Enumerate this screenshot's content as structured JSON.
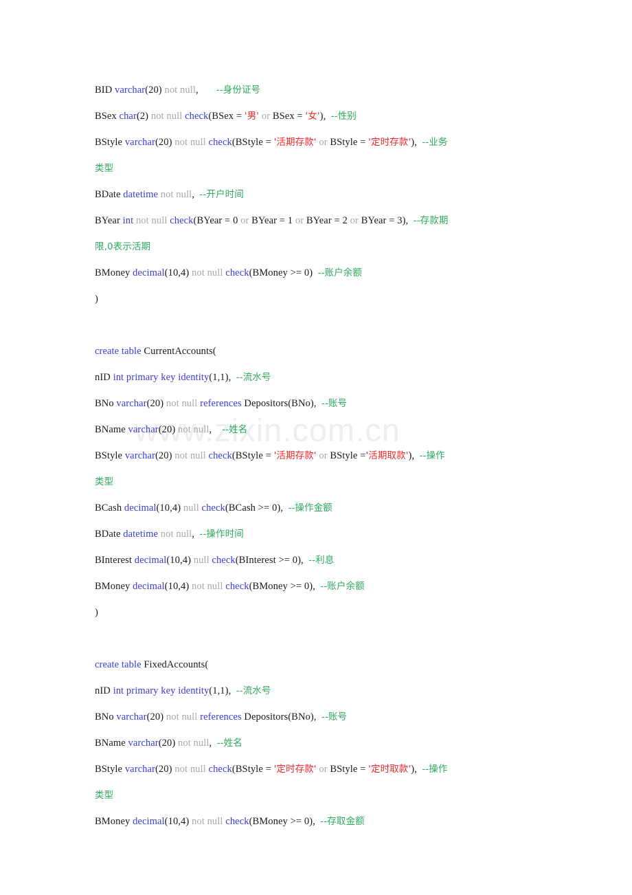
{
  "document": {
    "kind": "sql-source-listing",
    "watermark": "www.zixin.com.cn",
    "colors": {
      "keyword": "#3b3bd6",
      "nullable": "#a8a8a8",
      "comment": "#2ea95e",
      "string": "#ee2b2b",
      "identifier": "#1a1a1a",
      "background": "#ffffff",
      "watermark": "#eceff2"
    }
  },
  "lines": [
    {
      "id": "l01",
      "tokens": [
        {
          "t": "BID ",
          "c": "id"
        },
        {
          "t": "varchar",
          "c": "kw"
        },
        {
          "t": "(20) ",
          "c": "id"
        },
        {
          "t": "not null",
          "c": "nul"
        },
        {
          "t": ",       ",
          "c": "id"
        },
        {
          "t": "--身份证号",
          "c": "cmt"
        }
      ]
    },
    {
      "id": "l02",
      "tokens": [
        {
          "t": "BSex ",
          "c": "id"
        },
        {
          "t": "char",
          "c": "kw"
        },
        {
          "t": "(2) ",
          "c": "id"
        },
        {
          "t": "not null ",
          "c": "nul"
        },
        {
          "t": "check",
          "c": "kw"
        },
        {
          "t": "(BSex = ",
          "c": "id"
        },
        {
          "t": "'男'",
          "c": "str"
        },
        {
          "t": " or ",
          "c": "nul"
        },
        {
          "t": "BSex = ",
          "c": "id"
        },
        {
          "t": "'女'",
          "c": "str"
        },
        {
          "t": "),  ",
          "c": "id"
        },
        {
          "t": "--性别",
          "c": "cmt"
        }
      ]
    },
    {
      "id": "l03",
      "tokens": [
        {
          "t": "BStyle ",
          "c": "id"
        },
        {
          "t": "varchar",
          "c": "kw"
        },
        {
          "t": "(20) ",
          "c": "id"
        },
        {
          "t": "not null ",
          "c": "nul"
        },
        {
          "t": "check",
          "c": "kw"
        },
        {
          "t": "(BStyle = ",
          "c": "id"
        },
        {
          "t": "'活期存款'",
          "c": "str"
        },
        {
          "t": " or ",
          "c": "nul"
        },
        {
          "t": "BStyle = ",
          "c": "id"
        },
        {
          "t": "'定时存款'",
          "c": "str"
        },
        {
          "t": "),  ",
          "c": "id"
        },
        {
          "t": "--业务",
          "c": "cmt"
        }
      ]
    },
    {
      "id": "l04",
      "tokens": [
        {
          "t": "类型",
          "c": "cmt"
        }
      ]
    },
    {
      "id": "l05",
      "tokens": [
        {
          "t": "BDate ",
          "c": "id"
        },
        {
          "t": "datetime",
          "c": "kw"
        },
        {
          "t": " not null",
          "c": "nul"
        },
        {
          "t": ",  ",
          "c": "id"
        },
        {
          "t": "--开户时间",
          "c": "cmt"
        }
      ]
    },
    {
      "id": "l06",
      "tokens": [
        {
          "t": "BYear ",
          "c": "id"
        },
        {
          "t": "int",
          "c": "kw"
        },
        {
          "t": " not null ",
          "c": "nul"
        },
        {
          "t": "check",
          "c": "kw"
        },
        {
          "t": "(BYear = 0",
          "c": "id"
        },
        {
          "t": " or ",
          "c": "nul"
        },
        {
          "t": "BYear = 1",
          "c": "id"
        },
        {
          "t": " or ",
          "c": "nul"
        },
        {
          "t": "BYear = 2",
          "c": "id"
        },
        {
          "t": " or ",
          "c": "nul"
        },
        {
          "t": "BYear = 3),  ",
          "c": "id"
        },
        {
          "t": "--存款期",
          "c": "cmt"
        }
      ]
    },
    {
      "id": "l07",
      "tokens": [
        {
          "t": "限,0表示活期",
          "c": "cmt"
        }
      ]
    },
    {
      "id": "l08",
      "tokens": [
        {
          "t": "BMoney ",
          "c": "id"
        },
        {
          "t": "decimal",
          "c": "kw"
        },
        {
          "t": "(10,4) ",
          "c": "id"
        },
        {
          "t": "not null ",
          "c": "nul"
        },
        {
          "t": "check",
          "c": "kw"
        },
        {
          "t": "(BMoney >= 0)  ",
          "c": "id"
        },
        {
          "t": "--账户余额",
          "c": "cmt"
        }
      ]
    },
    {
      "id": "l09",
      "tokens": [
        {
          "t": ")",
          "c": "id"
        }
      ]
    },
    {
      "id": "l10",
      "tokens": []
    },
    {
      "id": "l11",
      "tokens": [
        {
          "t": "create table",
          "c": "kw"
        },
        {
          "t": " CurrentAccounts(",
          "c": "id"
        }
      ]
    },
    {
      "id": "l12",
      "tokens": [
        {
          "t": "nID ",
          "c": "id"
        },
        {
          "t": "int primary key identity",
          "c": "kw"
        },
        {
          "t": "(1,1),  ",
          "c": "id"
        },
        {
          "t": "--流水号",
          "c": "cmt"
        }
      ]
    },
    {
      "id": "l13",
      "tokens": [
        {
          "t": "BNo ",
          "c": "id"
        },
        {
          "t": "varchar",
          "c": "kw"
        },
        {
          "t": "(20) ",
          "c": "id"
        },
        {
          "t": "not null ",
          "c": "nul"
        },
        {
          "t": "references",
          "c": "kw"
        },
        {
          "t": " Depositors(BNo),  ",
          "c": "id"
        },
        {
          "t": "--账号",
          "c": "cmt"
        }
      ]
    },
    {
      "id": "l14",
      "tokens": [
        {
          "t": "BName ",
          "c": "id"
        },
        {
          "t": "varchar",
          "c": "kw"
        },
        {
          "t": "(20) ",
          "c": "id"
        },
        {
          "t": "not null",
          "c": "nul"
        },
        {
          "t": ",    ",
          "c": "id"
        },
        {
          "t": "--姓名",
          "c": "cmt"
        }
      ]
    },
    {
      "id": "l15",
      "tokens": [
        {
          "t": "BStyle ",
          "c": "id"
        },
        {
          "t": "varchar",
          "c": "kw"
        },
        {
          "t": "(20) ",
          "c": "id"
        },
        {
          "t": "not null ",
          "c": "nul"
        },
        {
          "t": "check",
          "c": "kw"
        },
        {
          "t": "(BStyle = ",
          "c": "id"
        },
        {
          "t": "'活期存款'",
          "c": "str"
        },
        {
          "t": " or ",
          "c": "nul"
        },
        {
          "t": "BStyle =",
          "c": "id"
        },
        {
          "t": "'活期取款'",
          "c": "str"
        },
        {
          "t": "),  ",
          "c": "id"
        },
        {
          "t": "--操作",
          "c": "cmt"
        }
      ]
    },
    {
      "id": "l16",
      "tokens": [
        {
          "t": "类型",
          "c": "cmt"
        }
      ]
    },
    {
      "id": "l17",
      "tokens": [
        {
          "t": "BCash ",
          "c": "id"
        },
        {
          "t": "decimal",
          "c": "kw"
        },
        {
          "t": "(10,4) ",
          "c": "id"
        },
        {
          "t": "null ",
          "c": "nul"
        },
        {
          "t": "check",
          "c": "kw"
        },
        {
          "t": "(BCash >= 0),  ",
          "c": "id"
        },
        {
          "t": "--操作金额",
          "c": "cmt"
        }
      ]
    },
    {
      "id": "l18",
      "tokens": [
        {
          "t": "BDate ",
          "c": "id"
        },
        {
          "t": "datetime",
          "c": "kw"
        },
        {
          "t": " not null",
          "c": "nul"
        },
        {
          "t": ",  ",
          "c": "id"
        },
        {
          "t": "--操作时间",
          "c": "cmt"
        }
      ]
    },
    {
      "id": "l19",
      "tokens": [
        {
          "t": "BInterest ",
          "c": "id"
        },
        {
          "t": "decimal",
          "c": "kw"
        },
        {
          "t": "(10,4) ",
          "c": "id"
        },
        {
          "t": "null ",
          "c": "nul"
        },
        {
          "t": "check",
          "c": "kw"
        },
        {
          "t": "(BInterest >= 0),  ",
          "c": "id"
        },
        {
          "t": "--利息",
          "c": "cmt"
        }
      ]
    },
    {
      "id": "l20",
      "tokens": [
        {
          "t": "BMoney ",
          "c": "id"
        },
        {
          "t": "decimal",
          "c": "kw"
        },
        {
          "t": "(10,4) ",
          "c": "id"
        },
        {
          "t": "not null ",
          "c": "nul"
        },
        {
          "t": "check",
          "c": "kw"
        },
        {
          "t": "(BMoney >= 0),  ",
          "c": "id"
        },
        {
          "t": "--账户余额",
          "c": "cmt"
        }
      ]
    },
    {
      "id": "l21",
      "tokens": [
        {
          "t": ")",
          "c": "id"
        }
      ]
    },
    {
      "id": "l22",
      "tokens": []
    },
    {
      "id": "l23",
      "tokens": [
        {
          "t": "create table",
          "c": "kw"
        },
        {
          "t": " FixedAccounts(",
          "c": "id"
        }
      ]
    },
    {
      "id": "l24",
      "tokens": [
        {
          "t": "nID ",
          "c": "id"
        },
        {
          "t": "int primary key identity",
          "c": "kw"
        },
        {
          "t": "(1,1),  ",
          "c": "id"
        },
        {
          "t": "--流水号",
          "c": "cmt"
        }
      ]
    },
    {
      "id": "l25",
      "tokens": [
        {
          "t": "BNo ",
          "c": "id"
        },
        {
          "t": "varchar",
          "c": "kw"
        },
        {
          "t": "(20) ",
          "c": "id"
        },
        {
          "t": "not null ",
          "c": "nul"
        },
        {
          "t": "references",
          "c": "kw"
        },
        {
          "t": " Depositors(BNo),  ",
          "c": "id"
        },
        {
          "t": "--账号",
          "c": "cmt"
        }
      ]
    },
    {
      "id": "l26",
      "tokens": [
        {
          "t": "BName ",
          "c": "id"
        },
        {
          "t": "varchar",
          "c": "kw"
        },
        {
          "t": "(20) ",
          "c": "id"
        },
        {
          "t": "not null",
          "c": "nul"
        },
        {
          "t": ",  ",
          "c": "id"
        },
        {
          "t": "--姓名",
          "c": "cmt"
        }
      ]
    },
    {
      "id": "l27",
      "tokens": [
        {
          "t": "BStyle ",
          "c": "id"
        },
        {
          "t": "varchar",
          "c": "kw"
        },
        {
          "t": "(20) ",
          "c": "id"
        },
        {
          "t": "not null ",
          "c": "nul"
        },
        {
          "t": "check",
          "c": "kw"
        },
        {
          "t": "(BStyle = ",
          "c": "id"
        },
        {
          "t": "'定时存款'",
          "c": "str"
        },
        {
          "t": " or ",
          "c": "nul"
        },
        {
          "t": "BStyle = ",
          "c": "id"
        },
        {
          "t": "'定时取款'",
          "c": "str"
        },
        {
          "t": "),  ",
          "c": "id"
        },
        {
          "t": "--操作",
          "c": "cmt"
        }
      ]
    },
    {
      "id": "l28",
      "tokens": [
        {
          "t": "类型",
          "c": "cmt"
        }
      ]
    },
    {
      "id": "l29",
      "tokens": [
        {
          "t": "BMoney ",
          "c": "id"
        },
        {
          "t": "decimal",
          "c": "kw"
        },
        {
          "t": "(10,4) ",
          "c": "id"
        },
        {
          "t": "not null ",
          "c": "nul"
        },
        {
          "t": "check",
          "c": "kw"
        },
        {
          "t": "(BMoney >= 0),  ",
          "c": "id"
        },
        {
          "t": "--存取金额",
          "c": "cmt"
        }
      ]
    }
  ]
}
